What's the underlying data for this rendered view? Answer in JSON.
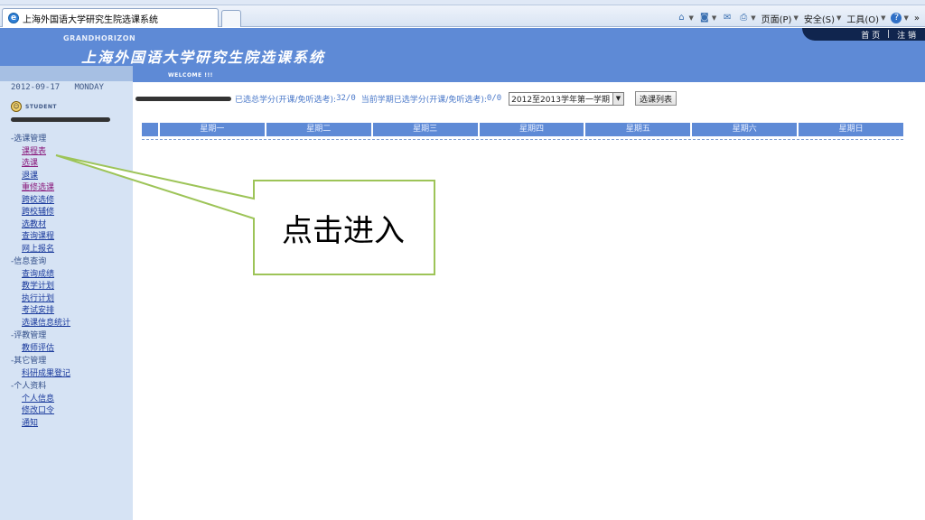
{
  "browser": {
    "tab_title": "上海外国语大学研究生院选课系统",
    "tab_icon": "e",
    "toolbar": {
      "home_icon": "home-icon",
      "feeds_icon": "rss-icon",
      "mail_icon": "mail-icon",
      "print_icon": "print-icon",
      "page_label": "页面(P)",
      "safety_label": "安全(S)",
      "tools_label": "工具(O)",
      "help_icon": "help-icon",
      "more": "»"
    }
  },
  "header": {
    "brand": "GRANDHORIZON",
    "title": "上海外国语大学研究生院选课系统",
    "welcome": "WELCOME !!!",
    "nav": {
      "home": "首 页",
      "separator": "|",
      "logout": "注 销"
    },
    "bg_color": "#5e8ad6"
  },
  "sidebar": {
    "date": "2012-09-17",
    "weekday": "MONDAY",
    "student_label": "STUDENT",
    "groups": [
      {
        "title": "-选课管理",
        "items": [
          {
            "label": "课程表",
            "visited": true
          },
          {
            "label": "选课",
            "visited": true
          },
          {
            "label": "退课",
            "visited": false
          },
          {
            "label": "重修选课",
            "visited": true
          },
          {
            "label": "跨校选修",
            "visited": false
          },
          {
            "label": "跨校辅修",
            "visited": false
          },
          {
            "label": "选教材",
            "visited": false
          },
          {
            "label": "查询课程",
            "visited": false
          },
          {
            "label": "网上报名",
            "visited": false
          }
        ]
      },
      {
        "title": "-信息查询",
        "items": [
          {
            "label": "查询成绩",
            "visited": false
          },
          {
            "label": "教学计划",
            "visited": false
          },
          {
            "label": "执行计划",
            "visited": false
          },
          {
            "label": "考试安排",
            "visited": false
          },
          {
            "label": "选课信息统计",
            "visited": false
          }
        ]
      },
      {
        "title": "-评教管理",
        "items": [
          {
            "label": "教师评估",
            "visited": false
          }
        ]
      },
      {
        "title": "-其它管理",
        "items": [
          {
            "label": "科研成果登记",
            "visited": false
          }
        ]
      },
      {
        "title": "-个人资料",
        "items": [
          {
            "label": "个人信息",
            "visited": false
          },
          {
            "label": "修改口令",
            "visited": false
          },
          {
            "label": "通知",
            "visited": false
          }
        ]
      }
    ]
  },
  "main": {
    "credits": {
      "total_label": "已选总学分(开课/免听选考):",
      "total_value": "32/0",
      "term_label": "当前学期已选学分(开课/免听选考):",
      "term_value": "0/0"
    },
    "term_select": {
      "value": "2012至2013学年第一学期"
    },
    "list_button": "选课列表",
    "weekdays": [
      "星期一",
      "星期二",
      "星期三",
      "星期四",
      "星期五",
      "星期六",
      "星期日"
    ]
  },
  "callout": {
    "text": "点击进入",
    "border_color": "#9dc458"
  }
}
